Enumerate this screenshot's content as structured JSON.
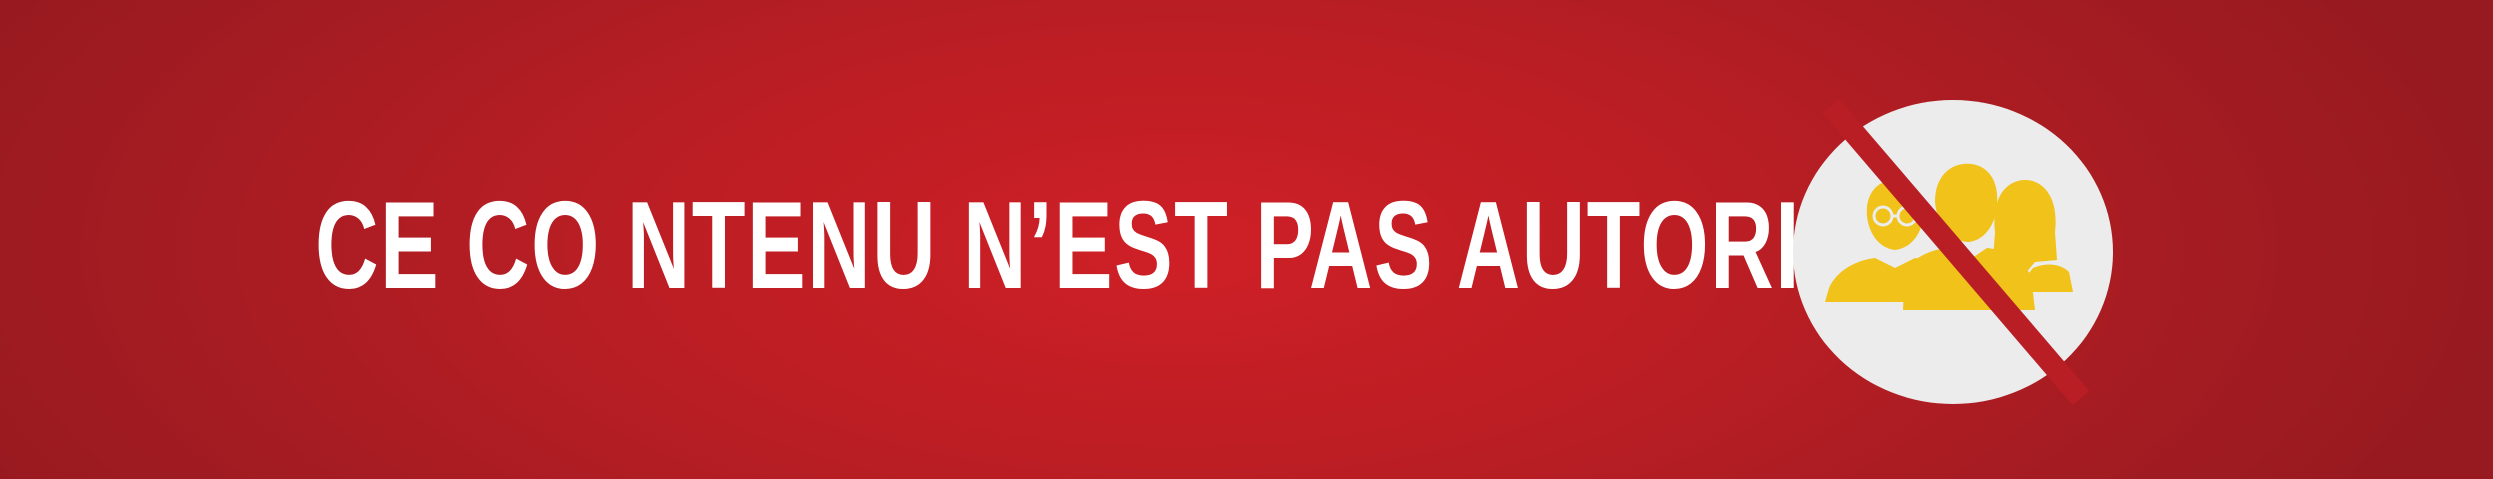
{
  "banner": {
    "message": "CE CO NTENU N’EST PAS AUTORISÉ",
    "icon": "no-people-icon",
    "colors": {
      "background": "#c11f26",
      "text": "#ffffff",
      "icon_circle": "#ececec",
      "icon_people": "#f0c21a",
      "prohibition_bar": "#b81e24"
    }
  }
}
